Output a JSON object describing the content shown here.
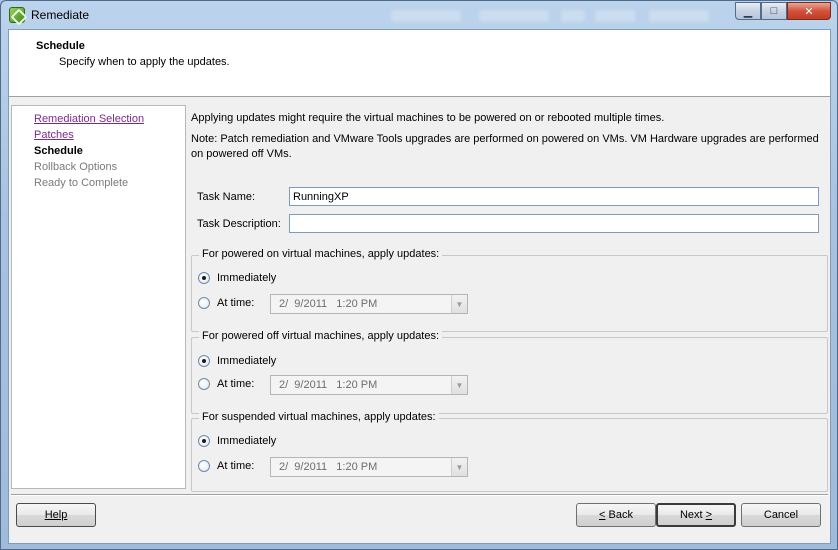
{
  "window": {
    "title": "Remediate",
    "caption_buttons": {
      "minimize": "▁",
      "maximize": "□",
      "close": "✕"
    }
  },
  "header": {
    "title": "Schedule",
    "subtitle": "Specify when to apply the updates."
  },
  "steps": [
    {
      "label": "Remediation Selection",
      "state": "link"
    },
    {
      "label": "Patches",
      "state": "link"
    },
    {
      "label": "Schedule",
      "state": "current"
    },
    {
      "label": "Rollback Options",
      "state": "future"
    },
    {
      "label": "Ready to Complete",
      "state": "future"
    }
  ],
  "content": {
    "info_line": "Applying updates might require the virtual machines to be powered on or rebooted multiple times.",
    "note": "Note: Patch remediation and VMware Tools upgrades are performed on powered on VMs. VM Hardware upgrades are performed on powered off VMs.",
    "task_name_label": "Task Name:",
    "task_name_value": "RunningXP",
    "task_description_label": "Task Description:",
    "task_description_value": ""
  },
  "groups": [
    {
      "legend": "For powered on virtual machines, apply updates:",
      "immediately_label": "Immediately",
      "at_time_label": "At time:",
      "selected": "immediately",
      "datetime": "2/  9/2011   1:20 PM"
    },
    {
      "legend": "For powered off virtual machines, apply updates:",
      "immediately_label": "Immediately",
      "at_time_label": "At time:",
      "selected": "immediately",
      "datetime": "2/  9/2011   1:20 PM"
    },
    {
      "legend": "For suspended virtual machines, apply updates:",
      "immediately_label": "Immediately",
      "at_time_label": "At time:",
      "selected": "immediately",
      "datetime": "2/  9/2011   1:20 PM"
    }
  ],
  "footer": {
    "help": "Help",
    "back_mnemonic": "<",
    "back_rest": " Back",
    "next_rest": "Next ",
    "next_mnemonic": ">",
    "cancel": "Cancel"
  },
  "icons": {
    "app": "vmware-remediate-icon",
    "dropdown": "chevron-down-icon"
  }
}
